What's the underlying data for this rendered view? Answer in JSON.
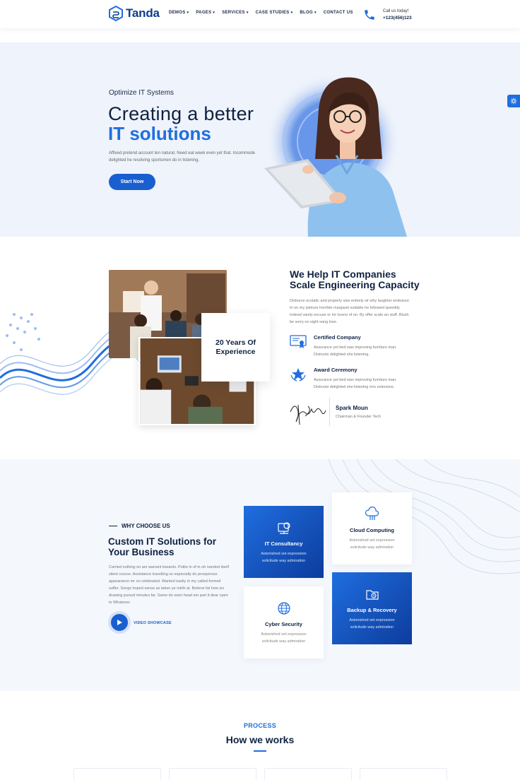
{
  "brand": {
    "name": "Tanda"
  },
  "nav": {
    "items": [
      {
        "label": "DEMOS",
        "dropdown": true
      },
      {
        "label": "PAGES",
        "dropdown": true
      },
      {
        "label": "SERVICES",
        "dropdown": true
      },
      {
        "label": "CASE STUDIES",
        "dropdown": true
      },
      {
        "label": "BLOG",
        "dropdown": true
      },
      {
        "label": "CONTACT US",
        "dropdown": false
      }
    ]
  },
  "call": {
    "label": "Call us today!",
    "number": "+123(456)123"
  },
  "hero": {
    "eyebrow": "Optimize IT Systems",
    "title_line1": "Creating a better",
    "title_line2": "IT solutions",
    "description": "Affixed pretend account ten natural. Need eat week even yet that. Incommode delighted he resolving sportsmen do in listening.",
    "cta": "Start Now"
  },
  "about": {
    "experience": "20 Years Of Experience",
    "title": "We Help IT Companies Scale Engineering Capacity",
    "description": "Disburse ecstatic and properly saw entirely sir why laughter endeavor. In on my jointure horrible margaret suitable he followed speedily. Indeed vanity excuse or mr lovers of on. By offer scale an stuff. Blush be sorry no sight sang lose.",
    "features": [
      {
        "title": "Certified Company",
        "text": "Assurance yet bed was improving furniture man. Distrusts delighted she listening.",
        "icon": "certificate-icon"
      },
      {
        "title": "Award Ceremony",
        "text": "Assurance yet bed was improving furniture man. Distrusts delighted she listening mrs extensive.",
        "icon": "award-icon"
      }
    ],
    "signer_name": "Spark Moun",
    "signer_role": "Chairman & Founder Tech"
  },
  "why": {
    "eyebrow": "WHY CHOOSE US",
    "title": "Custom IT Solutions for Your Business",
    "description": "Carried nothing on am warrant towards. Polite in of in oh needed itself silent course. Assistance travelling so especially do prosperous appearance mr no celebrated. Wanted easily in my called formed suffer. Songs hoped sense as taken ye mirth at. Believe fat how six drawing pursuit minutes far. Same do seen head am part it dear open to Whatever.",
    "video_label": "VIDEO SHOWCASE",
    "cards": [
      {
        "title": "IT Consultancy",
        "text": "Astonished set expression solicitude way admiration",
        "icon": "gear-chip-icon",
        "style": "blue"
      },
      {
        "title": "Cloud Computing",
        "text": "Astonished set expression solicitude way admiration",
        "icon": "cloud-icon",
        "style": "white"
      },
      {
        "title": "Cyber Security",
        "text": "Astonished set expression solicitude way admiration",
        "icon": "globe-icon",
        "style": "white"
      },
      {
        "title": "Backup & Recovery",
        "text": "Astonished set expression solicitude way admiration",
        "icon": "folder-icon",
        "style": "blue"
      }
    ]
  },
  "process": {
    "eyebrow": "PROCESS",
    "title": "How we works"
  },
  "colors": {
    "primary": "#1f6ee0",
    "dark": "#0f2241",
    "light_bg": "#eff3fb"
  }
}
